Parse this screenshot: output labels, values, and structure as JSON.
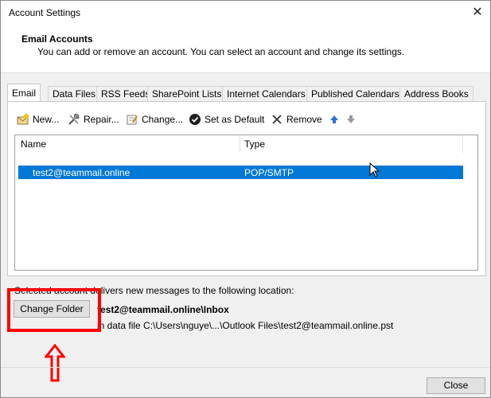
{
  "window": {
    "title": "Account Settings",
    "close_glyph": "✕"
  },
  "header": {
    "title": "Email Accounts",
    "description": "You can add or remove an account. You can select an account and change its settings."
  },
  "tabs": [
    {
      "label": "Email",
      "active": true
    },
    {
      "label": "Data Files"
    },
    {
      "label": "RSS Feeds"
    },
    {
      "label": "SharePoint Lists"
    },
    {
      "label": "Internet Calendars"
    },
    {
      "label": "Published Calendars"
    },
    {
      "label": "Address Books"
    }
  ],
  "toolbar": {
    "new_label": "New...",
    "repair_label": "Repair...",
    "change_label": "Change...",
    "default_label": "Set as Default",
    "remove_label": "Remove",
    "icons": {
      "new": "new-mail-icon",
      "repair": "repair-tools-icon",
      "change": "change-icon",
      "default": "checkmark-icon",
      "remove": "remove-x-icon",
      "up": "move-up-icon",
      "down": "move-down-icon"
    }
  },
  "accounts_list": {
    "columns": [
      "Name",
      "Type"
    ],
    "rows": [
      {
        "name": "test2@teammail.online",
        "type": "POP/SMTP",
        "selected": true
      }
    ]
  },
  "location": {
    "label": "Selected account delivers new messages to the following location:",
    "change_folder_label": "Change Folder",
    "folder": "test2@teammail.online\\Inbox",
    "datafile": "in data file C:\\Users\\nguye\\...\\Outlook Files\\test2@teammail.online.pst"
  },
  "footer": {
    "close_label": "Close"
  },
  "colors": {
    "selection": "#0078d7",
    "annotation": "#ff0000",
    "up_arrow": "#2d6fd3",
    "down_arrow": "#9a9a9a"
  }
}
